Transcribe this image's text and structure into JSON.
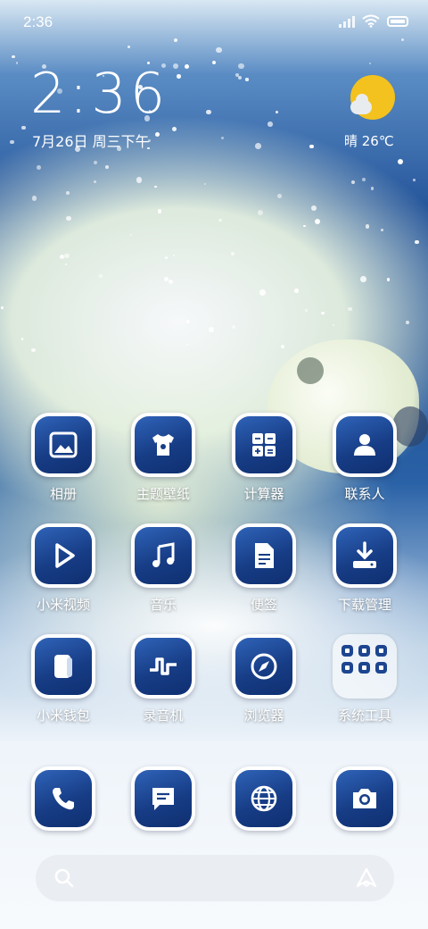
{
  "status_bar": {
    "time": "2:36"
  },
  "clock_widget": {
    "time": "2:36",
    "date": "7月26日 周三下午"
  },
  "weather_widget": {
    "text": "晴 26℃",
    "sun_color": "#F4C21E"
  },
  "theme": {
    "icon_gradient_start": "#2F63B8",
    "icon_gradient_end": "#0F2F70",
    "tile_border": "#FFFFFF"
  },
  "apps": [
    {
      "label": "相册",
      "icon": "gallery-icon"
    },
    {
      "label": "主题壁纸",
      "icon": "tshirt-icon"
    },
    {
      "label": "计算器",
      "icon": "calculator-icon"
    },
    {
      "label": "联系人",
      "icon": "person-icon"
    },
    {
      "label": "小米视频",
      "icon": "play-icon"
    },
    {
      "label": "音乐",
      "icon": "music-note-icon"
    },
    {
      "label": "便签",
      "icon": "note-icon"
    },
    {
      "label": "下载管理",
      "icon": "download-icon"
    },
    {
      "label": "小米钱包",
      "icon": "wallet-icon"
    },
    {
      "label": "录音机",
      "icon": "waveform-icon"
    },
    {
      "label": "浏览器",
      "icon": "compass-icon"
    },
    {
      "label": "系统工具",
      "icon": "folder-icon"
    }
  ],
  "dock": [
    {
      "name": "phone",
      "icon": "phone-icon"
    },
    {
      "name": "messages",
      "icon": "message-icon"
    },
    {
      "name": "browser",
      "icon": "globe-icon"
    },
    {
      "name": "camera",
      "icon": "camera-icon"
    }
  ],
  "search_bar": {
    "search_icon": "search-icon",
    "assistant_icon": "xiaoai-icon"
  }
}
